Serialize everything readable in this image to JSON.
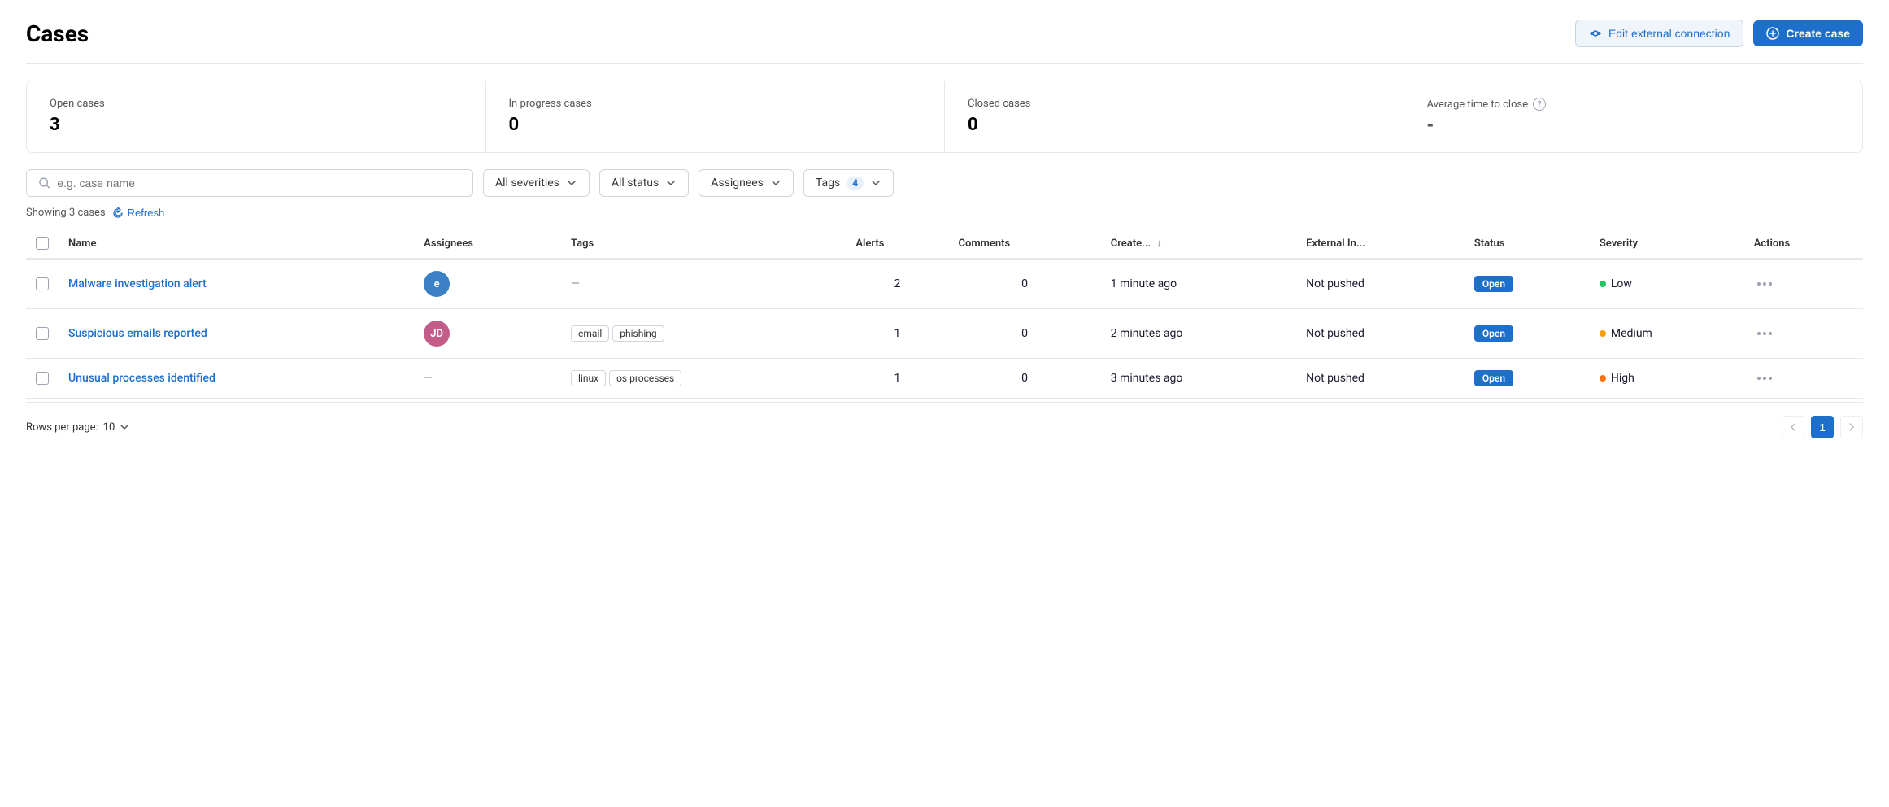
{
  "page": {
    "title": "Cases"
  },
  "header": {
    "edit_connection_label": "Edit external connection",
    "create_case_label": "Create case"
  },
  "stats": {
    "open_cases_label": "Open cases",
    "open_cases_value": "3",
    "in_progress_label": "In progress cases",
    "in_progress_value": "0",
    "closed_label": "Closed cases",
    "closed_value": "0",
    "avg_time_label": "Average time to close",
    "avg_time_value": "-"
  },
  "filters": {
    "search_placeholder": "e.g. case name",
    "severities_label": "All severities",
    "status_label": "All status",
    "assignees_label": "Assignees",
    "tags_label": "Tags",
    "tags_count": "4"
  },
  "table_meta": {
    "showing_text": "Showing 3 cases",
    "refresh_label": "Refresh"
  },
  "columns": {
    "name": "Name",
    "assignees": "Assignees",
    "tags": "Tags",
    "alerts": "Alerts",
    "comments": "Comments",
    "created": "Create...",
    "external_in": "External In...",
    "status": "Status",
    "severity": "Severity",
    "actions": "Actions"
  },
  "cases": [
    {
      "id": 1,
      "name": "Malware investigation alert",
      "assignee_initials": "e",
      "assignee_color": "avatar-e",
      "tags": [],
      "tags_display": "—",
      "alerts": "2",
      "comments": "0",
      "created": "1 minute ago",
      "external_in": "Not pushed",
      "status": "Open",
      "severity": "Low",
      "severity_dot": "dot-low"
    },
    {
      "id": 2,
      "name": "Suspicious emails reported",
      "assignee_initials": "JD",
      "assignee_color": "avatar-jd",
      "tags": [
        "email",
        "phishing"
      ],
      "tags_display": "",
      "alerts": "1",
      "comments": "0",
      "created": "2 minutes ago",
      "external_in": "Not pushed",
      "status": "Open",
      "severity": "Medium",
      "severity_dot": "dot-medium"
    },
    {
      "id": 3,
      "name": "Unusual processes identified",
      "assignee_initials": "",
      "assignee_color": "",
      "tags": [
        "linux",
        "os processes"
      ],
      "tags_display": "",
      "alerts": "1",
      "comments": "0",
      "created": "3 minutes ago",
      "external_in": "Not pushed",
      "status": "Open",
      "severity": "High",
      "severity_dot": "dot-high"
    }
  ],
  "footer": {
    "rows_per_page_label": "Rows per page:",
    "rows_per_page_value": "10",
    "current_page": "1"
  }
}
